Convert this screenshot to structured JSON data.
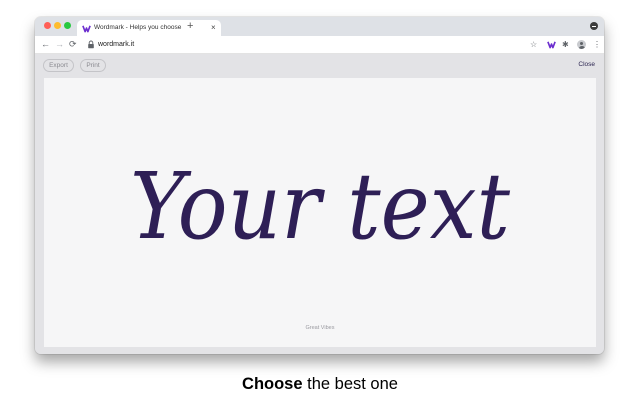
{
  "browser": {
    "tab_title": "Wordmark - Helps you choose",
    "tab_close": "×",
    "new_tab": "+",
    "url": "wordmark.it",
    "nav": {
      "back": "←",
      "forward": "→",
      "reload": "⟳"
    },
    "icons": {
      "star": "☆",
      "puzzle": "✱",
      "menu": "⋮"
    }
  },
  "app": {
    "export_label": "Export",
    "print_label": "Print",
    "close_label": "Close",
    "preview_text": "Your text",
    "font_name": "Great Vibes",
    "text_color": "#2e1f56"
  },
  "caption": {
    "strong": "Choose",
    "rest": " the best one"
  }
}
